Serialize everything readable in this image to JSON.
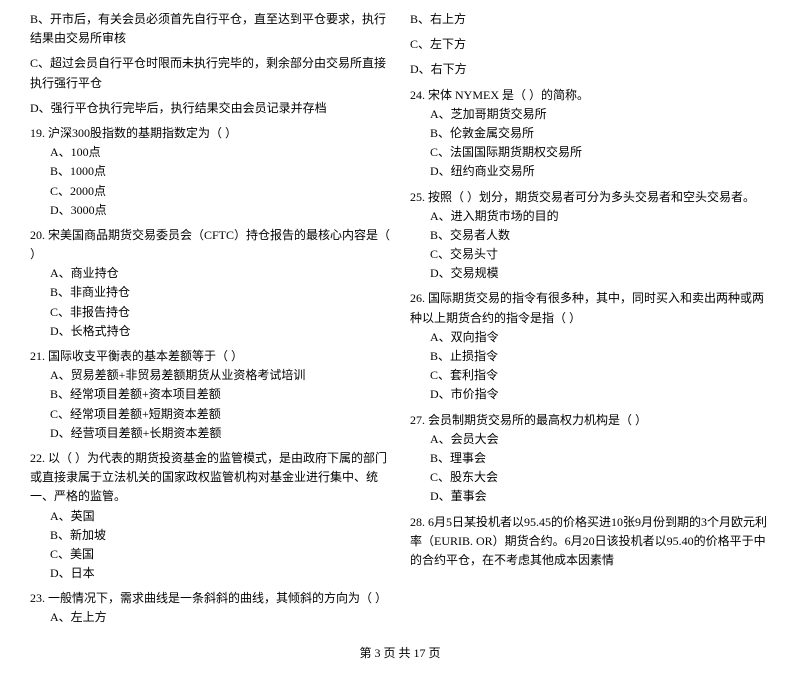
{
  "questions": [
    {
      "id": "q_b1",
      "col": 1,
      "number": "",
      "text": "B、开市后，有关会员必须首先自行平仓，直至达到平仓要求，执行结果由交易所审核",
      "options": []
    },
    {
      "id": "q_c1",
      "col": 1,
      "number": "",
      "text": "C、超过会员自行平仓时限而未执行完毕的，剩余部分由交易所直接执行强行平仓",
      "options": []
    },
    {
      "id": "q_d1",
      "col": 1,
      "number": "",
      "text": "D、强行平仓执行完毕后，执行结果交由会员记录并存档",
      "options": []
    },
    {
      "id": "q19",
      "col": 1,
      "number": "19.",
      "text": "19. 沪深300股指数的基期指数定为（    ）",
      "options": [
        "A、100点",
        "B、1000点",
        "C、2000点",
        "D、3000点"
      ]
    },
    {
      "id": "q20",
      "col": 1,
      "number": "20.",
      "text": "20. 宋美国商品期货交易委员会（CFTC）持仓报告的最核心内容是（    ）",
      "options": [
        "A、商业持仓",
        "B、非商业持仓",
        "C、非报告持仓",
        "D、长格式持仓"
      ]
    },
    {
      "id": "q21",
      "col": 1,
      "number": "21.",
      "text": "21. 国际收支平衡表的基本差额等于（    ）",
      "options": [
        "A、贸易差额+非贸易差额期货从业资格考试培训",
        "B、经常项目差额+资本项目差额",
        "C、经常项目差额+短期资本差额",
        "D、经营项目差额+长期资本差额"
      ]
    },
    {
      "id": "q22",
      "col": 1,
      "number": "22.",
      "text": "22. 以（    ）为代表的期货投资基金的监管模式，是由政府下属的部门或直接隶属于立法机关的国家政权监管机构对基金业进行集中、统一、严格的监管。",
      "options": [
        "A、英国",
        "B、新加坡",
        "C、美国",
        "D、日本"
      ]
    },
    {
      "id": "q23",
      "col": 1,
      "number": "23.",
      "text": "23. 一般情况下，需求曲线是一条斜斜的曲线，其倾斜的方向为（    ）",
      "options": [
        "A、左上方"
      ]
    },
    {
      "id": "q_b2r",
      "col": 2,
      "number": "",
      "text": "B、右上方",
      "options": []
    },
    {
      "id": "q_c2r",
      "col": 2,
      "number": "",
      "text": "C、左下方",
      "options": []
    },
    {
      "id": "q_d2r",
      "col": 2,
      "number": "",
      "text": "D、右下方",
      "options": []
    },
    {
      "id": "q24",
      "col": 2,
      "number": "24.",
      "text": "24. 宋体 NYMEX 是（    ）的简称。",
      "options": [
        "A、芝加哥期货交易所",
        "B、伦敦金属交易所",
        "C、法国国际期货期权交易所",
        "D、纽约商业交易所"
      ]
    },
    {
      "id": "q25",
      "col": 2,
      "number": "25.",
      "text": "25. 按照（    ）划分，期货交易者可分为多头交易者和空头交易者。",
      "options": [
        "A、进入期货市场的目的",
        "B、交易者人数",
        "C、交易头寸",
        "D、交易规模"
      ]
    },
    {
      "id": "q26",
      "col": 2,
      "number": "26.",
      "text": "26. 国际期货交易的指令有很多种，其中，同时买入和卖出两种或两种以上期货合约的指令是指（    ）",
      "options": [
        "A、双向指令",
        "B、止损指令",
        "C、套利指令",
        "D、市价指令"
      ]
    },
    {
      "id": "q27",
      "col": 2,
      "number": "27.",
      "text": "27. 会员制期货交易所的最高权力机构是（    ）",
      "options": [
        "A、会员大会",
        "B、理事会",
        "C、股东大会",
        "D、董事会"
      ]
    },
    {
      "id": "q28",
      "col": 2,
      "number": "28.",
      "text": "28. 6月5日某投机者以95.45的价格买进10张9月份到期的3个月欧元利率（EURIB. OR）期货合约。6月20日该投机者以95.40的价格平于中的合约平仓，在不考虑其他成本因素情",
      "options": []
    }
  ],
  "footer": {
    "page_info": "第 3 页 共 17 页"
  }
}
